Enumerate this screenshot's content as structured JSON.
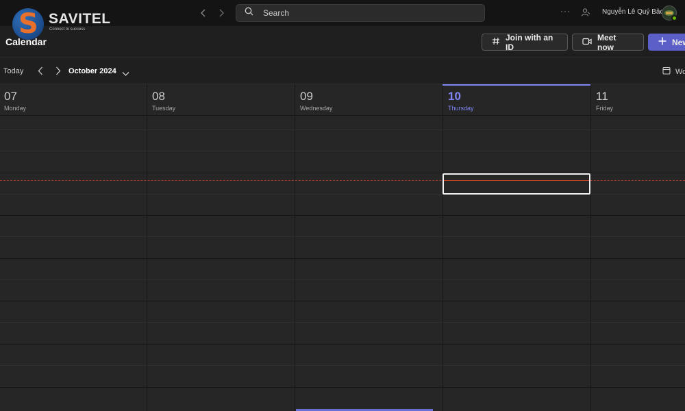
{
  "brand": {
    "logo_letter": "S",
    "name": "SAVITEL",
    "tagline": "Connect to success"
  },
  "topbar": {
    "search_placeholder": "Search",
    "more_label": "···",
    "user_name": "Nguyễn Lê Quý Bảo"
  },
  "header": {
    "title": "Calendar",
    "join_label": "Join with an ID",
    "meet_label": "Meet now",
    "new_label": "New"
  },
  "nav": {
    "today_label": "Today",
    "month_label": "October 2024",
    "view_label": "Wo"
  },
  "days": [
    {
      "num": "07",
      "name": "Monday"
    },
    {
      "num": "08",
      "name": "Tuesday"
    },
    {
      "num": "09",
      "name": "Wednesday"
    },
    {
      "num": "10",
      "name": "Thursday",
      "is_today": true
    },
    {
      "num": "11",
      "name": "Friday"
    }
  ],
  "colors": {
    "accent": "#5b5fc7",
    "today": "#7f85f5",
    "current_time": "#c4452a"
  },
  "icons": {
    "search": "search-icon",
    "back": "chevron-left-icon",
    "forward": "chevron-right-icon",
    "people": "people-icon",
    "hash": "hash-icon",
    "video": "video-icon",
    "plus": "plus-icon",
    "calendar_view": "calendar-view-icon"
  }
}
